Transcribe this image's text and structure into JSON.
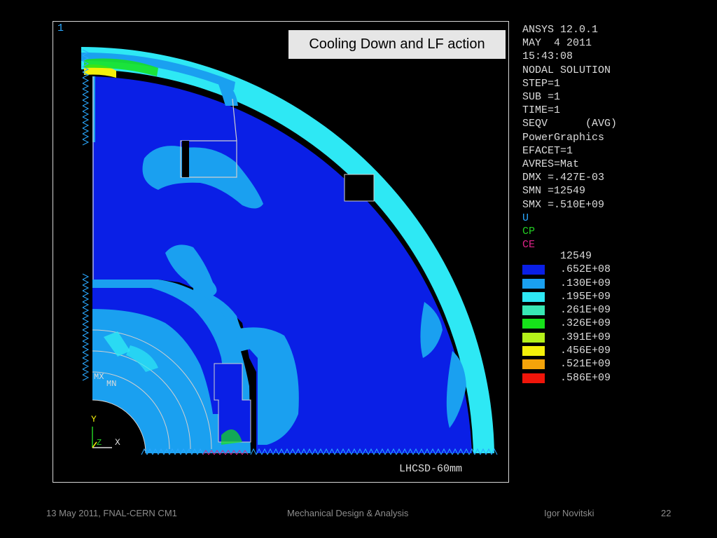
{
  "slide": {
    "callout": "Cooling Down and LF action",
    "footer": {
      "date_meeting": "13 May 2011, FNAL-CERN CM1",
      "topic": "Mechanical Design & Analysis",
      "author": "Igor Novitski",
      "page_number": "22"
    }
  },
  "plot": {
    "window_number": "1",
    "model_label": "LHCSD-60mm",
    "axis_y_label": "Y",
    "axis_x_label": "X",
    "axis_z_label": "Z",
    "mx_label": "MX",
    "mn_label": "MN"
  },
  "info": {
    "lines": [
      {
        "text": "ANSYS 12.0.1",
        "color": "#dcdcdc"
      },
      {
        "text": "MAY  4 2011",
        "color": "#dcdcdc"
      },
      {
        "text": "15:43:08",
        "color": "#dcdcdc"
      },
      {
        "text": "NODAL SOLUTION",
        "color": "#dcdcdc"
      },
      {
        "text": "STEP=1",
        "color": "#dcdcdc"
      },
      {
        "text": "SUB =1",
        "color": "#dcdcdc"
      },
      {
        "text": "TIME=1",
        "color": "#dcdcdc"
      },
      {
        "text": "SEQV      (AVG)",
        "color": "#dcdcdc"
      },
      {
        "text": "PowerGraphics",
        "color": "#dcdcdc"
      },
      {
        "text": "EFACET=1",
        "color": "#dcdcdc"
      },
      {
        "text": "AVRES=Mat",
        "color": "#dcdcdc"
      },
      {
        "text": "DMX =.427E-03",
        "color": "#dcdcdc"
      },
      {
        "text": "SMN =12549",
        "color": "#dcdcdc"
      },
      {
        "text": "SMX =.510E+09",
        "color": "#dcdcdc"
      },
      {
        "text": "U",
        "color": "#2aa8ff"
      },
      {
        "text": "CP",
        "color": "#22cc22"
      },
      {
        "text": "CE",
        "color": "#dd2288"
      }
    ]
  },
  "legend": {
    "min_label": "12549",
    "entries": [
      {
        "color": "#0a1fe6",
        "label": ".652E+08"
      },
      {
        "color": "#1aa0f0",
        "label": ".130E+09"
      },
      {
        "color": "#2ee8f4",
        "label": ".195E+09"
      },
      {
        "color": "#38e8b4",
        "label": ".261E+09"
      },
      {
        "color": "#16e21a",
        "label": ".326E+09"
      },
      {
        "color": "#b4f01a",
        "label": ".391E+09"
      },
      {
        "color": "#f4f00a",
        "label": ".456E+09"
      },
      {
        "color": "#f4a30a",
        "label": ".521E+09"
      },
      {
        "color": "#f0150a",
        "label": ".586E+09"
      }
    ]
  }
}
